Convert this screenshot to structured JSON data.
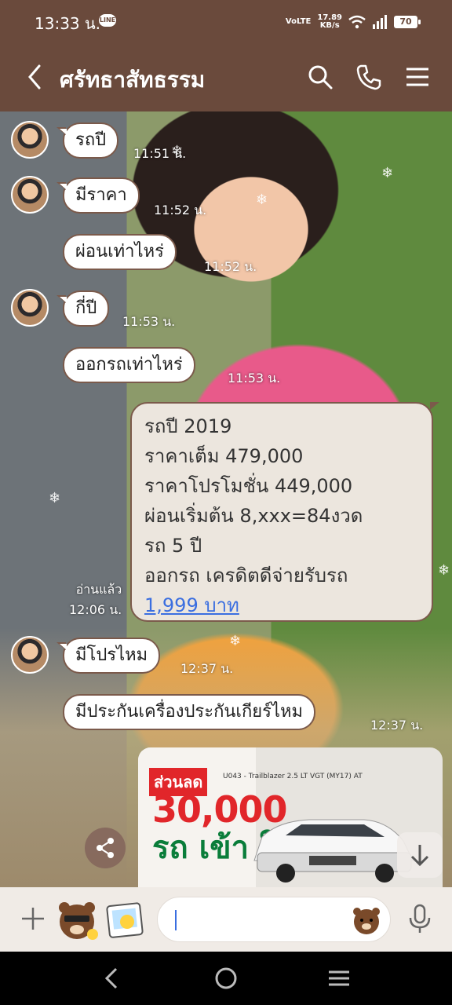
{
  "status_bar": {
    "time": "13:33 น.",
    "app_badge": "LINE",
    "network": "VoLTE",
    "net_speed_value": "17.89",
    "net_speed_unit": "KB/s",
    "battery": "70"
  },
  "header": {
    "title": "ศรัทธาสัทธรรม"
  },
  "messages": [
    {
      "text": "รถปี",
      "time": "11:51 น."
    },
    {
      "text": "มีราคา",
      "time": "11:52 น."
    },
    {
      "text": "ผ่อนเท่าไหร่",
      "time": "11:52 น."
    },
    {
      "text": "กี่ปี",
      "time": "11:53 น."
    },
    {
      "text": "ออกรถเท่าไหร่",
      "time": "11:53 น."
    },
    {
      "text": "มีโปรไหม",
      "time": "12:37 น."
    },
    {
      "text": "มีประกันเครื่องประกันเกียร์ไหม",
      "time": "12:37 น."
    }
  ],
  "outgoing": {
    "lines": [
      "รถปี 2019",
      "ราคาเต็ม 479,000",
      "ราคาโปรโมชั่น 449,000",
      "ผ่อนเริ่มต้น 8,xxx=84งวด",
      "รถ 5 ปี",
      "ออกรถ เครดิตดีจ่ายรับรถ"
    ],
    "link": "1,999 บาท",
    "read_label": "อ่านแล้ว",
    "time": "12:06 น."
  },
  "image_card": {
    "sale_label": "ส่วนลด",
    "amount": "30,000",
    "green_text": "รถ เข้า ใหม่",
    "model_text": "U043 - Trailblazer 2.5 LT VGT (MY17) AT"
  },
  "input": {
    "placeholder": ""
  }
}
